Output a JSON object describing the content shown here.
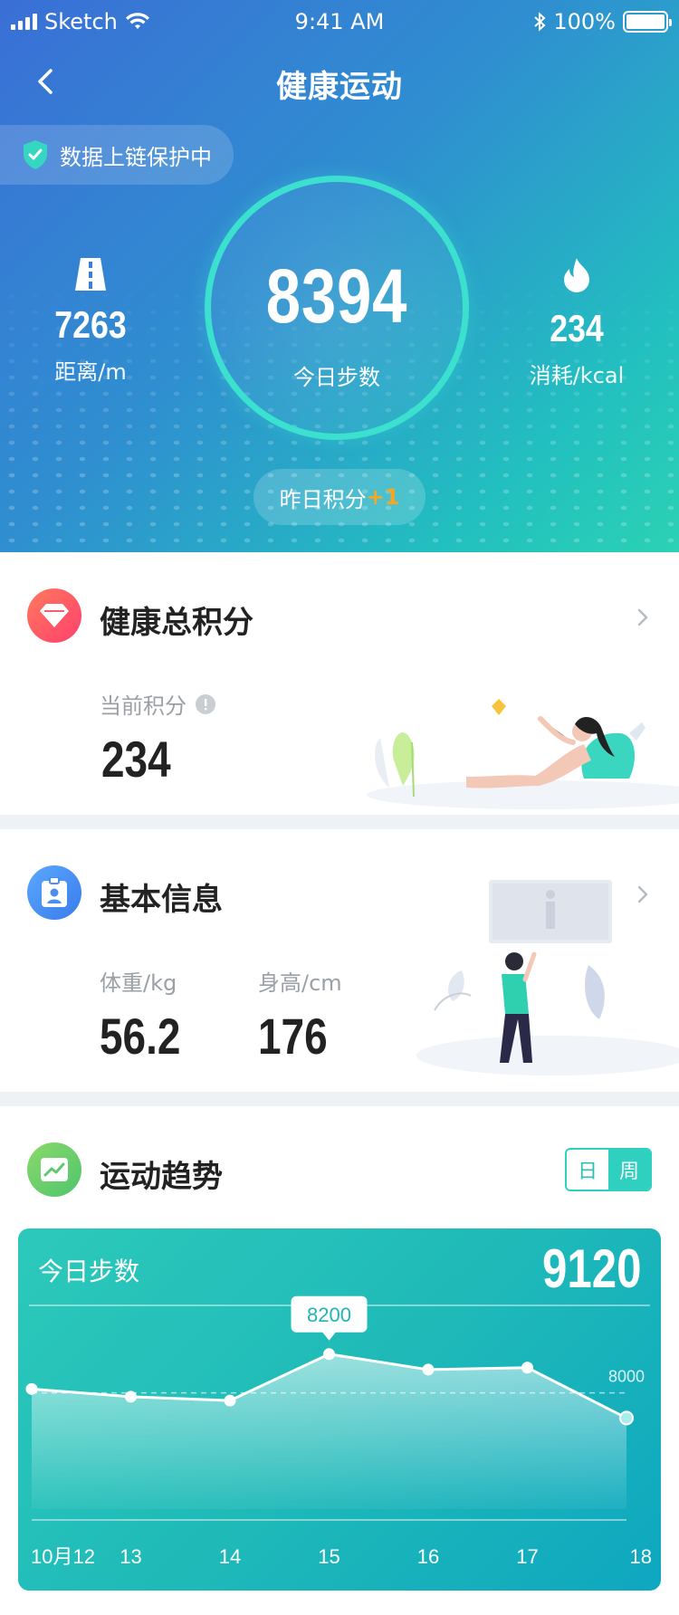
{
  "status_bar": {
    "carrier": "Sketch",
    "time": "9:41 AM",
    "battery": "100%"
  },
  "nav": {
    "title": "健康运动"
  },
  "chain_pill": {
    "label": "数据上链保护中"
  },
  "hero": {
    "distance": {
      "value": "7263",
      "label": "距离/m"
    },
    "steps": {
      "value": "8394",
      "label": "今日步数"
    },
    "calories": {
      "value": "234",
      "label": "消耗/kcal"
    },
    "yesterday": {
      "label": "昨日积分",
      "plus": "+1"
    }
  },
  "points_card": {
    "title": "健康总积分",
    "current_label": "当前积分",
    "current_value": "234"
  },
  "info_card": {
    "title": "基本信息",
    "weight_label": "体重/kg",
    "weight_value": "56.2",
    "height_label": "身高/cm",
    "height_value": "176"
  },
  "trend_card": {
    "title": "运动趋势",
    "toggle_day": "日",
    "toggle_week": "周",
    "panel_title": "今日步数",
    "panel_value": "9120",
    "highlight_label": "8200",
    "reference_label": "8000"
  },
  "colors": {
    "accent": "#2fd0c0",
    "hero_start": "#3a6fd6",
    "hero_end": "#2bd2b4",
    "points_icon": "#ff5a6e",
    "info_icon": "#4a8ff0",
    "trend_icon": "#6ccf6a",
    "bonus": "#f5a623"
  },
  "chart_data": {
    "type": "area",
    "x": [
      "10月12",
      "13",
      "14",
      "15",
      "16",
      "17",
      "18"
    ],
    "series": [
      {
        "values": [
          8020,
          7980,
          7960,
          8200,
          8120,
          8130,
          7870
        ]
      }
    ],
    "reference_line": 8000,
    "highlight": {
      "x": "15",
      "value": 8200
    },
    "ylim": [
      7400,
      8400
    ],
    "grid": false
  }
}
